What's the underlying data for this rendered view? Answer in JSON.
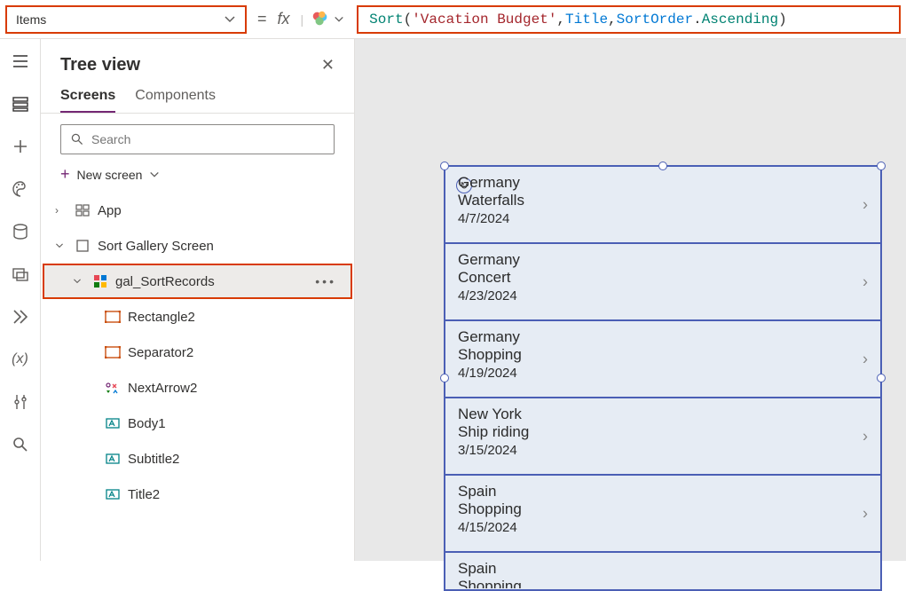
{
  "property_dropdown": {
    "value": "Items"
  },
  "formula": {
    "fn": "Sort",
    "open": "(",
    "arg1": "'Vacation Budget'",
    "comma1": ",",
    "arg2": "Title",
    "comma2": ",",
    "arg3a": "SortOrder",
    "dot": ".",
    "arg3b": "Ascending",
    "close": ")"
  },
  "tree": {
    "title": "Tree view",
    "tabs": {
      "screens": "Screens",
      "components": "Components"
    },
    "search_placeholder": "Search",
    "new_screen": "New screen",
    "app": "App",
    "sort_screen": "Sort Gallery Screen",
    "gal": "gal_SortRecords",
    "children": {
      "rect": "Rectangle2",
      "sep": "Separator2",
      "next": "NextArrow2",
      "body": "Body1",
      "subtitle": "Subtitle2",
      "title": "Title2"
    }
  },
  "gallery_items": [
    {
      "title": "Germany",
      "subtitle": "Waterfalls",
      "date": "4/7/2024"
    },
    {
      "title": "Germany",
      "subtitle": "Concert",
      "date": "4/23/2024"
    },
    {
      "title": "Germany",
      "subtitle": "Shopping",
      "date": "4/19/2024"
    },
    {
      "title": "New York",
      "subtitle": "Ship riding",
      "date": "3/15/2024"
    },
    {
      "title": "Spain",
      "subtitle": "Shopping",
      "date": "4/15/2024"
    },
    {
      "title": "Spain",
      "subtitle": "Shopping",
      "date": ""
    }
  ]
}
